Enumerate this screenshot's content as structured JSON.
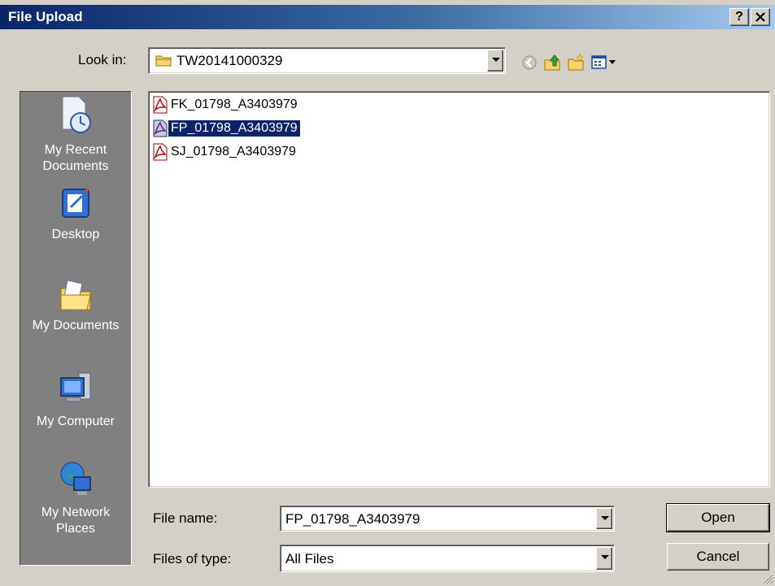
{
  "window": {
    "title": "File Upload",
    "help_button": "?",
    "close_button": "✕"
  },
  "lookin": {
    "label": "Look in:",
    "value": "TW20141000329"
  },
  "toolbar": {
    "icons": [
      "back-icon",
      "up-folder-icon",
      "new-folder-icon",
      "views-menu-icon"
    ]
  },
  "places": [
    {
      "label": "My Recent\nDocuments",
      "icon": "recent-documents-icon"
    },
    {
      "label": "Desktop",
      "icon": "desktop-icon"
    },
    {
      "label": "My Documents",
      "icon": "my-documents-icon"
    },
    {
      "label": "My Computer",
      "icon": "my-computer-icon"
    },
    {
      "label": "My Network\nPlaces",
      "icon": "network-places-icon"
    }
  ],
  "files": [
    {
      "name": "FK_01798_A3403979",
      "icon": "pdf-icon",
      "selected": false
    },
    {
      "name": "FP_01798_A3403979",
      "icon": "pdf-icon",
      "selected": true
    },
    {
      "name": "SJ_01798_A3403979",
      "icon": "pdf-icon",
      "selected": false
    }
  ],
  "filename": {
    "label": "File name:",
    "value": "FP_01798_A3403979"
  },
  "filetype": {
    "label": "Files of type:",
    "value": "All Files"
  },
  "buttons": {
    "open": "Open",
    "cancel": "Cancel"
  },
  "colors": {
    "title_gradient_start": "#0a246a",
    "title_gradient_end": "#a6caf0",
    "selection": "#0a246a",
    "dialog_bg": "#d4d0c8",
    "places_bg": "#808080"
  }
}
